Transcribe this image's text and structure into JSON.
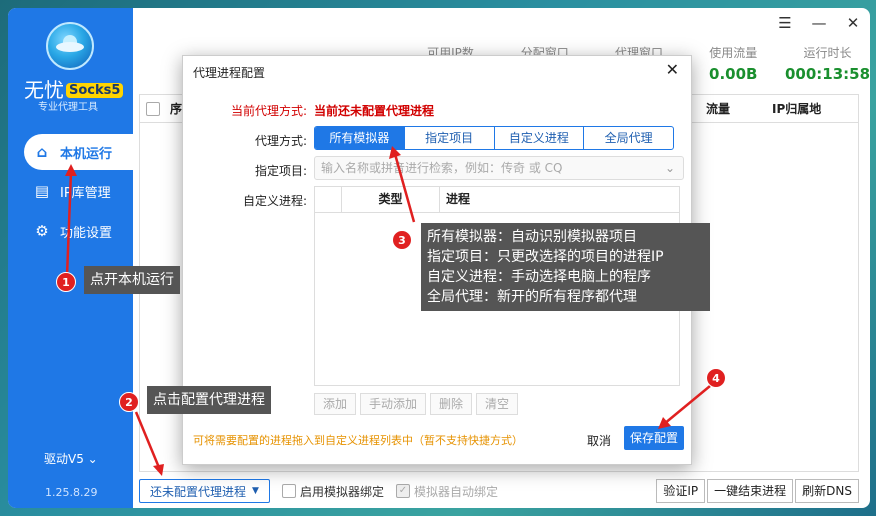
{
  "sidebar": {
    "brand": "无忧",
    "brand_tag": "Socks5",
    "subtitle": "专业代理工具",
    "items": [
      {
        "label": "本机运行",
        "icon": "home-icon"
      },
      {
        "label": "IP库管理",
        "icon": "list-icon"
      },
      {
        "label": "功能设置",
        "icon": "gear-icon"
      }
    ],
    "driver": "驱动V5 ⌄",
    "version": "1.25.8.29"
  },
  "stats": {
    "available_ip_label": "可用IP数",
    "assigned_label": "分配窗口",
    "proxy_label": "代理窗口",
    "traffic_label": "使用流量",
    "traffic_value": "0.00B",
    "runtime_label": "运行时长",
    "runtime_value": "000:13:58"
  },
  "table": {
    "columns": [
      "序",
      "流量",
      "IP归属地"
    ]
  },
  "bottombar": {
    "config_button": "还未配置代理进程",
    "emu_bind": "启用模拟器绑定",
    "emu_auto": "模拟器自动绑定",
    "verify_ip": "验证IP",
    "end_all": "一键结束进程",
    "refresh_dns": "刷新DNS"
  },
  "dialog": {
    "title": "代理进程配置",
    "current_label": "当前代理方式:",
    "current_value": "当前还未配置代理进程",
    "mode_label": "代理方式:",
    "modes": [
      "所有模拟器",
      "指定项目",
      "自定义进程",
      "全局代理"
    ],
    "project_label": "指定项目:",
    "project_placeholder": "输入名称或拼音进行检索，例如：传奇 或 CQ",
    "custom_label": "自定义进程:",
    "grid_cols": [
      "类型",
      "进程"
    ],
    "grid_buttons": [
      "添加",
      "手动添加",
      "删除",
      "清空"
    ],
    "hint": "可将需要配置的进程拖入到自定义进程列表中（暂不支持快捷方式）",
    "cancel": "取消",
    "save": "保存配置"
  },
  "annotations": {
    "tip1": "点开本机运行",
    "tip2": "点击配置代理进程",
    "tip3_lines": [
      "所有模拟器：自动识别模拟器项目",
      "指定项目：只更改选择的项目的进程IP",
      "自定义进程：手动选择电脑上的程序",
      "全局代理：新开的所有程序都代理"
    ],
    "badges": [
      "1",
      "2",
      "3",
      "4"
    ]
  }
}
